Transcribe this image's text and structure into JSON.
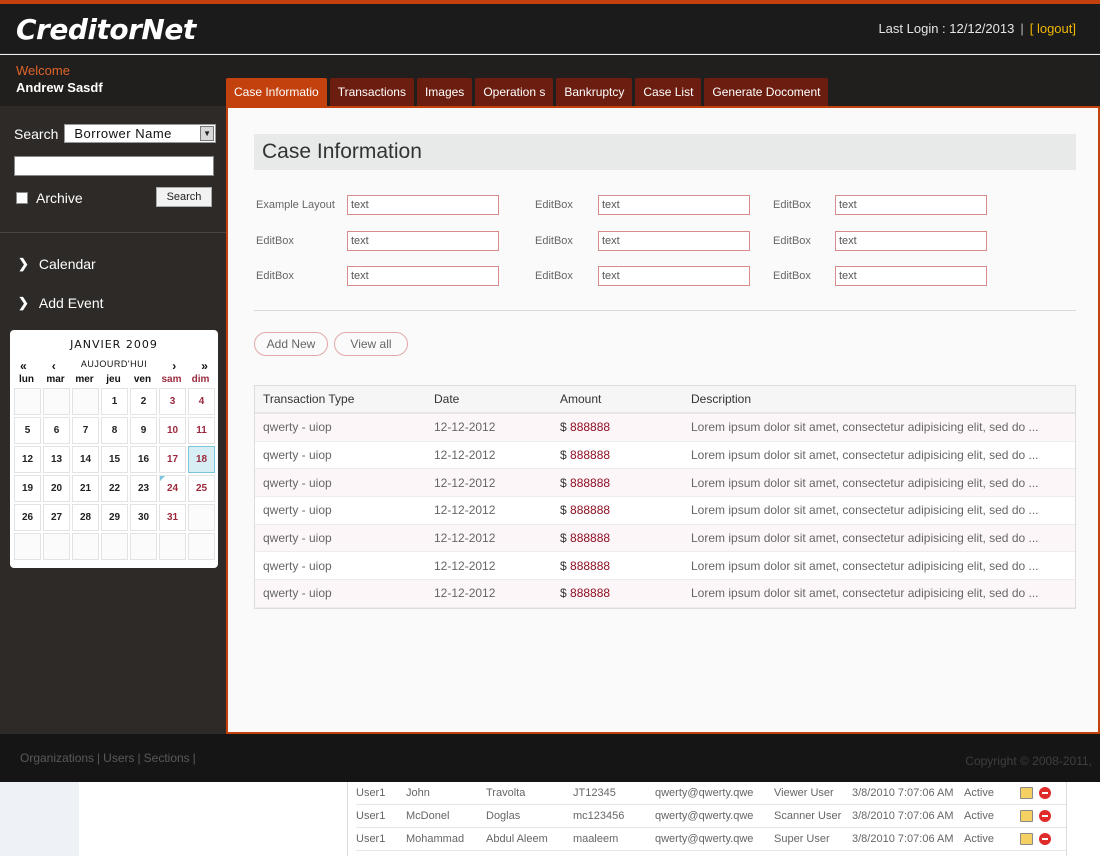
{
  "header": {
    "logo": "CreditorNet",
    "last_login": "Last Login : 12/12/2013",
    "separator": "|",
    "logout": "[ logout]"
  },
  "welcome": {
    "greeting": "Welcome",
    "user": "Andrew Sasdf"
  },
  "tabs": [
    {
      "label": "Case Informatio",
      "active": true
    },
    {
      "label": "Transactions"
    },
    {
      "label": "Images"
    },
    {
      "label": "Operation  s"
    },
    {
      "label": "Bankruptcy"
    },
    {
      "label": "Case List"
    },
    {
      "label": "Generate Docoment"
    }
  ],
  "sidebar": {
    "search_label": "Search",
    "search_select": "Borrower Name",
    "search_input": "",
    "archive_label": "Archive",
    "search_button": "Search",
    "links": [
      "Calendar",
      "Add Event"
    ]
  },
  "calendar": {
    "title": "JANVIER 2009",
    "nav": {
      "prev_year": "«",
      "prev_month": "‹",
      "today": "AUJOURD'HUI",
      "next_month": "›",
      "next_year": "»"
    },
    "weekdays": [
      "lun",
      "mar",
      "mer",
      "jeu",
      "ven",
      "sam",
      "dim"
    ],
    "weeks": [
      [
        "",
        "",
        "",
        "1",
        "2",
        "3",
        "4"
      ],
      [
        "5",
        "6",
        "7",
        "8",
        "9",
        "10",
        "11"
      ],
      [
        "12",
        "13",
        "14",
        "15",
        "16",
        "17",
        "18"
      ],
      [
        "19",
        "20",
        "21",
        "22",
        "23",
        "24",
        "25"
      ],
      [
        "26",
        "27",
        "28",
        "29",
        "30",
        "31",
        ""
      ],
      [
        "",
        "",
        "",
        "",
        "",
        "",
        ""
      ]
    ],
    "today_day": "18",
    "marked_day": "24"
  },
  "main": {
    "title": "Case Information",
    "form": [
      [
        {
          "label": "Example Layout",
          "value": "text"
        },
        {
          "label": "EditBox",
          "value": "text"
        },
        {
          "label": "EditBox",
          "value": "text"
        }
      ],
      [
        {
          "label": "EditBox",
          "value": "text"
        },
        {
          "label": "EditBox",
          "value": "text"
        },
        {
          "label": "EditBox",
          "value": "text"
        }
      ],
      [
        {
          "label": "EditBox",
          "value": "text"
        },
        {
          "label": "EditBox",
          "value": "text"
        },
        {
          "label": "EditBox",
          "value": "text"
        }
      ]
    ],
    "buttons": {
      "add_new": "Add New",
      "view_all": "View all"
    },
    "table": {
      "columns": [
        "Transaction Type",
        "Date",
        "Amount",
        "Description"
      ],
      "rows": [
        {
          "type": "qwerty - uiop",
          "date": "12-12-2012",
          "currency": "$",
          "amount": "888888",
          "description": "Lorem ipsum dolor sit amet, consectetur adipisicing elit, sed do ..."
        },
        {
          "type": "qwerty - uiop",
          "date": "12-12-2012",
          "currency": "$",
          "amount": "888888",
          "description": "Lorem ipsum dolor sit amet, consectetur adipisicing elit, sed do ..."
        },
        {
          "type": "qwerty - uiop",
          "date": "12-12-2012",
          "currency": "$",
          "amount": "888888",
          "description": "Lorem ipsum dolor sit amet, consectetur adipisicing elit, sed do ..."
        },
        {
          "type": "qwerty - uiop",
          "date": "12-12-2012",
          "currency": "$",
          "amount": "888888",
          "description": "Lorem ipsum dolor sit amet, consectetur adipisicing elit, sed do ..."
        },
        {
          "type": "qwerty - uiop",
          "date": "12-12-2012",
          "currency": "$",
          "amount": "888888",
          "description": "Lorem ipsum dolor sit amet, consectetur adipisicing elit, sed do ..."
        },
        {
          "type": "qwerty - uiop",
          "date": "12-12-2012",
          "currency": "$",
          "amount": "888888",
          "description": "Lorem ipsum dolor sit amet, consectetur adipisicing elit, sed do ..."
        },
        {
          "type": "qwerty - uiop",
          "date": "12-12-2012",
          "currency": "$",
          "amount": "888888",
          "description": "Lorem ipsum dolor sit amet, consectetur adipisicing elit, sed do ..."
        }
      ]
    }
  },
  "footer": {
    "links": [
      "Organizations",
      "Users",
      "Sections"
    ],
    "pipe": "|",
    "copyright": "Copyright © 2008-2011,"
  },
  "user_table": {
    "rows": [
      [
        "User1",
        "John",
        "Travolta",
        "JT12345",
        "qwerty@qwerty.qwe",
        "Viewer User",
        "3/8/2010 7:07:06 AM",
        "Active"
      ],
      [
        "User1",
        "McDonel",
        "Doglas",
        "mc123456",
        "qwerty@qwerty.qwe",
        "Scanner User",
        "3/8/2010 7:07:06 AM",
        "Active"
      ],
      [
        "User1",
        "Mohammad",
        "Abdul Aleem",
        "maaleem",
        "qwerty@qwerty.qwe",
        "Super User",
        "3/8/2010 7:07:06 AM",
        "Active"
      ]
    ],
    "icons": [
      "edit-icon",
      "delete-icon"
    ]
  },
  "colors": {
    "accent": "#c2410c",
    "tab_bg": "#6b1d0f",
    "header_bg": "#1b1b1b",
    "sidebar_bg": "#2d2a27",
    "logout": "#f2b705",
    "amount": "#8b0a1e",
    "weekend": "#9b2a3e"
  }
}
